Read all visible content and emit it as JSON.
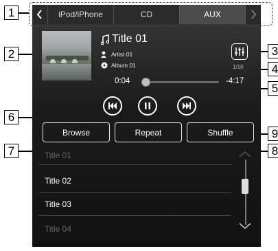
{
  "callouts": [
    "1",
    "2",
    "3",
    "4",
    "5",
    "6",
    "7",
    "8",
    "9"
  ],
  "tabs": {
    "items": [
      {
        "label": "iPod/iPhone",
        "active": false
      },
      {
        "label": "CD",
        "active": false
      },
      {
        "label": "AUX",
        "active": true
      }
    ]
  },
  "now_playing": {
    "title": "Title 01",
    "artist": "Artist 01",
    "album": "Album 01",
    "count": "1/10",
    "elapsed": "0:04",
    "remaining": "-4:17",
    "progress": 0.03
  },
  "buttons": {
    "browse": "Browse",
    "repeat": "Repeat",
    "shuffle": "Shuffle"
  },
  "list": {
    "items": [
      "Title 01",
      "Title 02",
      "Title 03",
      "Title 04"
    ]
  },
  "icons": {
    "prev_tab": "chevron-left-icon",
    "next_tab": "chevron-right-icon",
    "note": "music-note-icon",
    "artist": "person-icon",
    "album": "disc-icon",
    "sound": "equalizer-icon",
    "prev": "skip-previous-icon",
    "pause": "pause-icon",
    "next": "skip-next-icon",
    "scroll_up": "chevron-up-icon",
    "scroll_down": "chevron-down-icon"
  },
  "colors": {
    "screen": "#1b1b1b",
    "text": "#ffffff",
    "callout_border": "#000000"
  }
}
